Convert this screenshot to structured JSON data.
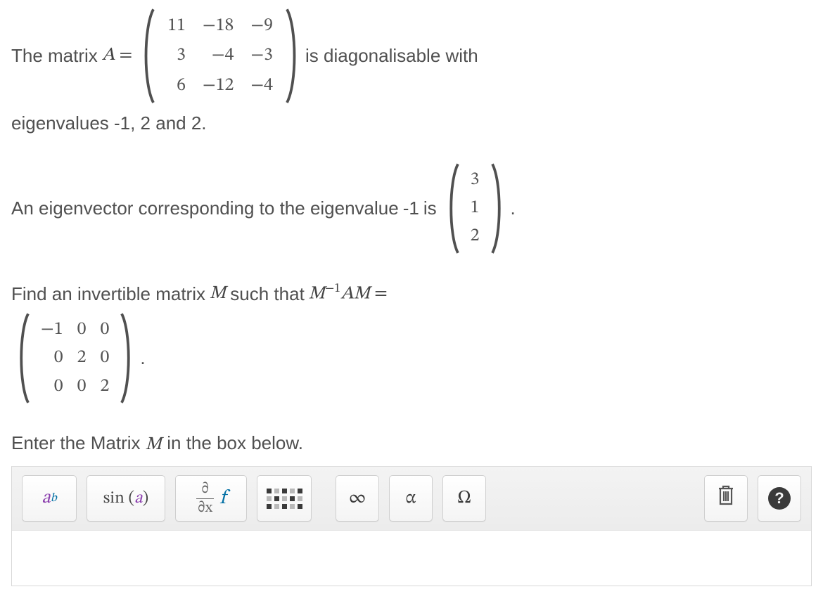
{
  "intro": {
    "prefix": "The matrix ",
    "matrix_var": "A",
    "equals": " = ",
    "suffix": " is diagonalisable with",
    "eigenline": "eigenvalues -1, 2 and 2."
  },
  "A": [
    [
      "11",
      "−18",
      "−9"
    ],
    [
      "3",
      "−4",
      "−3"
    ],
    [
      "6",
      "−12",
      "−4"
    ]
  ],
  "eigvec_sentence": {
    "prefix": "An eigenvector corresponding to the eigenvalue ",
    "value": "-1",
    "middle": " is ",
    "period": "."
  },
  "v": [
    [
      "3"
    ],
    [
      "1"
    ],
    [
      "2"
    ]
  ],
  "find_sentence": {
    "prefix": "Find an invertible matrix ",
    "M": "M",
    "middle": " such that ",
    "expr_pre": "M",
    "expr_sup": "−1",
    "expr_mid": "AM",
    "equals": " ="
  },
  "D": [
    [
      "−1",
      "0",
      "0"
    ],
    [
      "0",
      "2",
      "0"
    ],
    [
      "0",
      "0",
      "2"
    ]
  ],
  "D_period": ".",
  "enter_prompt": {
    "pre": "Enter the Matrix ",
    "M": "M",
    "post": "  in the box below."
  },
  "toolbar": {
    "power": {
      "base": "a",
      "exp": "b"
    },
    "trig": {
      "label_pre": "sin",
      "open": " (",
      "a": "a",
      "close": ")"
    },
    "deriv": {
      "num": "∂",
      "den": "∂x",
      "f": "f"
    },
    "infinity": "∞",
    "alpha": "α",
    "omega": "Ω",
    "help": "?"
  }
}
